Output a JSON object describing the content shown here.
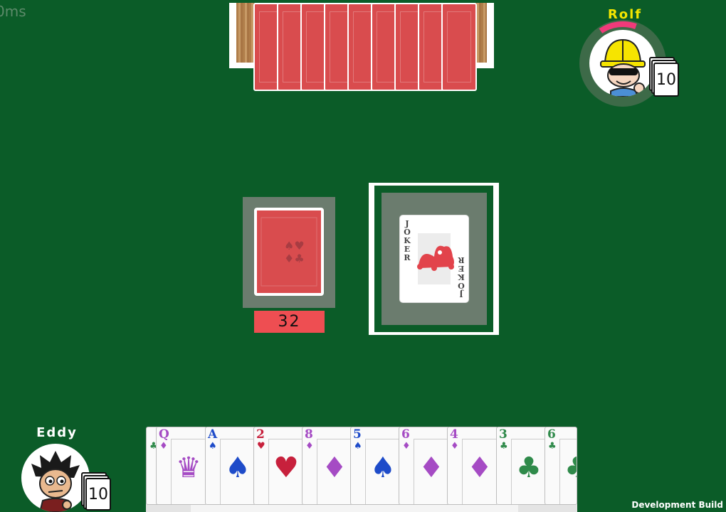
{
  "latency": "0ms",
  "opponent": {
    "name": "Rolf",
    "card_count": "10",
    "turn_progress": 0.15,
    "accent": "#f4e600",
    "timer_color": "#f03a7a"
  },
  "player": {
    "name": "Eddy",
    "card_count": "10"
  },
  "deck": {
    "remaining": "32"
  },
  "discard": {
    "top_card": "JOKER"
  },
  "hand": [
    {
      "rank": "",
      "suit": "clubs",
      "color": "#2f8a4a"
    },
    {
      "rank": "Q",
      "suit": "diamonds",
      "color": "#a54bc4"
    },
    {
      "rank": "A",
      "suit": "spades",
      "color": "#1e4bc9"
    },
    {
      "rank": "2",
      "suit": "hearts",
      "color": "#c7203c"
    },
    {
      "rank": "8",
      "suit": "diamonds",
      "color": "#a54bc4"
    },
    {
      "rank": "5",
      "suit": "spades",
      "color": "#1e4bc9"
    },
    {
      "rank": "6",
      "suit": "diamonds",
      "color": "#a54bc4"
    },
    {
      "rank": "4",
      "suit": "diamonds",
      "color": "#a54bc4"
    },
    {
      "rank": "3",
      "suit": "clubs",
      "color": "#2f8a4a"
    },
    {
      "rank": "6",
      "suit": "clubs",
      "color": "#2f8a4a"
    }
  ],
  "footer": {
    "build_label": "Development Build"
  }
}
